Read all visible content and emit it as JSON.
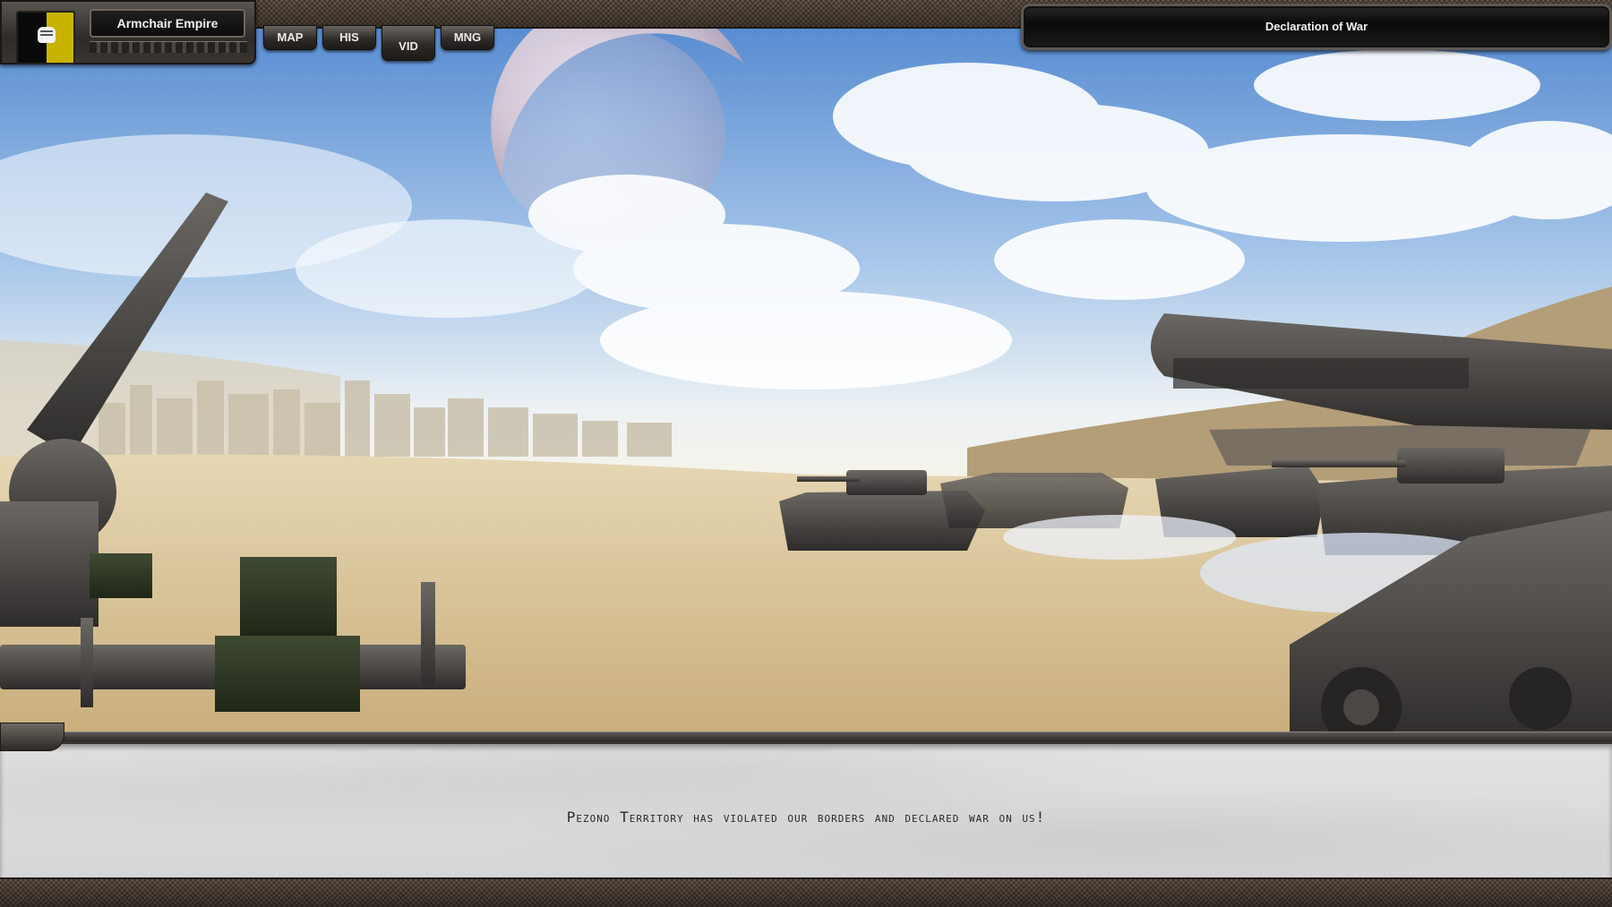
{
  "header": {
    "empire_name": "Armchair Empire",
    "flag_colors": [
      "#0a0a0a",
      "#c7b400"
    ],
    "flag_icon": "fist-icon"
  },
  "tabs": [
    {
      "label": "MAP",
      "active": false
    },
    {
      "label": "HIS",
      "active": false
    },
    {
      "label": "VID",
      "active": true
    },
    {
      "label": "MNG",
      "active": false
    }
  ],
  "title_panel": {
    "title": "Declaration of War"
  },
  "message": {
    "text": "Pezono Territory has violated our borders and declared war on us!"
  },
  "scene": {
    "description_icon": "war-scene-icon",
    "sky_color": "#5f93d4",
    "sand_color": "#d8c39a"
  }
}
